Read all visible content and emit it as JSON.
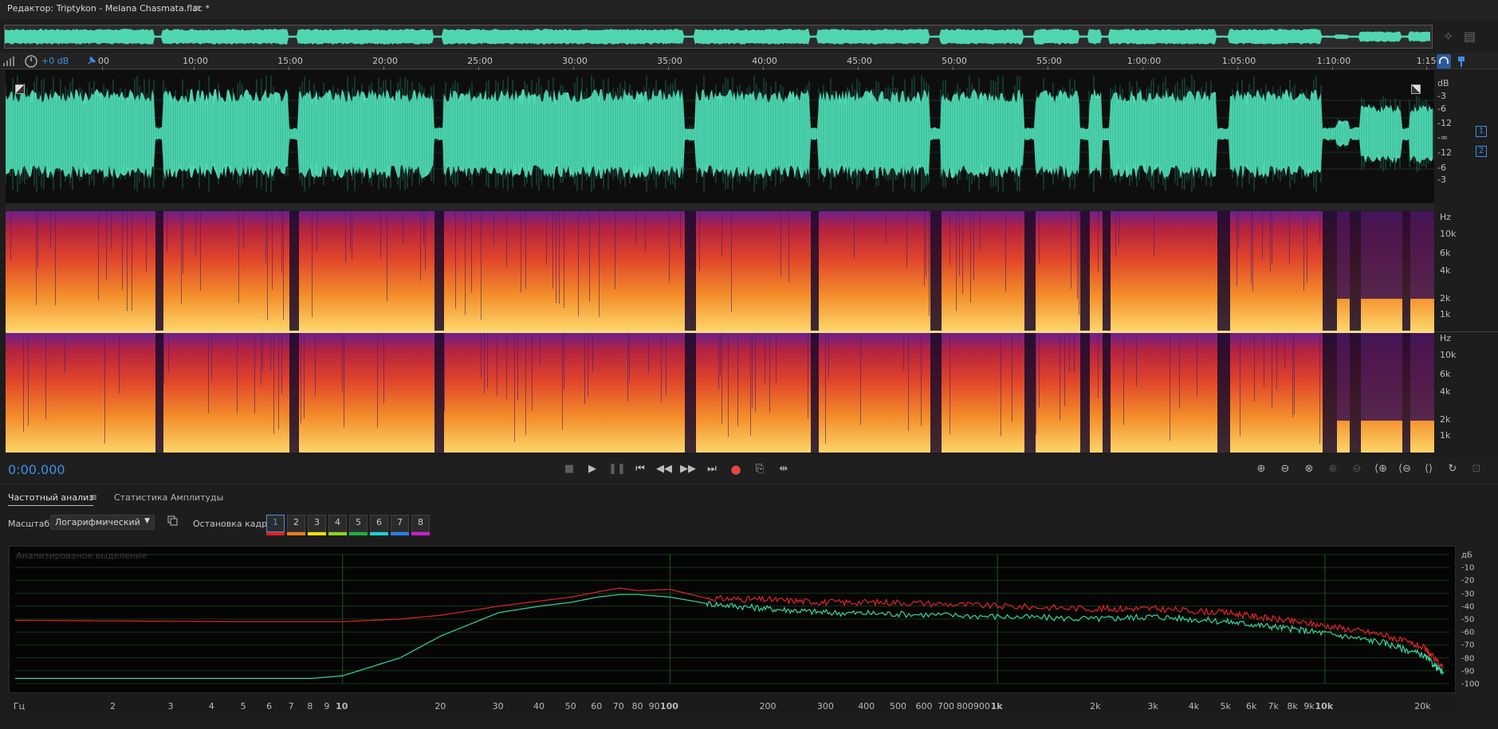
{
  "window": {
    "title": "Редактор: Triptykon - Melana Chasmata.flac *",
    "menu_icon": "hamburger-menu-icon"
  },
  "header": {
    "gain": "+0 dB"
  },
  "timeline": {
    "ticks": [
      "00",
      "10:00",
      "15:00",
      "20:00",
      "25:00",
      "30:00",
      "35:00",
      "40:00",
      "45:00",
      "50:00",
      "55:00",
      "1:00:00",
      "1:05:00",
      "1:10:00",
      "1:15:"
    ]
  },
  "waveform": {
    "db_labels": [
      "dB",
      "-3",
      "-6",
      "-12",
      "-∞",
      "-12",
      "-6",
      "-3"
    ],
    "channels": [
      "1",
      "2"
    ],
    "color": "#4fd6b0"
  },
  "spectrogram": {
    "labels": [
      "Hz",
      "10k",
      "6k",
      "4k",
      "2k",
      "1k"
    ]
  },
  "transport": {
    "time": "0:00.000",
    "buttons": [
      "stop-icon",
      "play-icon",
      "pause-icon",
      "skip-start-icon",
      "rewind-icon",
      "fast-forward-icon",
      "skip-end-icon",
      "record-icon",
      "loop-icon",
      "skip-selection-icon"
    ],
    "zoom_buttons": [
      "zoom-in-amplitude-icon",
      "zoom-out-amplitude-icon",
      "zoom-reset-icon",
      "zoom-in-time-icon",
      "zoom-out-time-icon",
      "zoom-selection-icon",
      "zoom-in-left-icon",
      "zoom-in-right-icon",
      "zoom-full-icon",
      "zoom-fit-icon",
      "zoom-extra-icon"
    ]
  },
  "panel": {
    "tab_active": "Частотный анализ",
    "tab_other": "Статистика Амплитуды",
    "scale_label": "Масштаб:",
    "scale_value": "Логарифмический",
    "freeze_label": "Остановка кадра:",
    "holds": [
      {
        "label": "1",
        "color": "#e02020"
      },
      {
        "label": "2",
        "color": "#f07d17"
      },
      {
        "label": "3",
        "color": "#f2e000"
      },
      {
        "label": "4",
        "color": "#8cd61a"
      },
      {
        "label": "5",
        "color": "#1ab43c"
      },
      {
        "label": "6",
        "color": "#14d6d6"
      },
      {
        "label": "7",
        "color": "#2a7df0"
      },
      {
        "label": "8",
        "color": "#d11ad1"
      }
    ]
  },
  "chart_data": {
    "type": "line",
    "note": "Анализированое выделение",
    "xscale": "log",
    "xlim": [
      1,
      24000
    ],
    "ylim": [
      -100,
      0
    ],
    "ylabel": "дБ",
    "x_ticks": [
      "Гц",
      "2",
      "3",
      "4",
      "5",
      "6",
      "7",
      "8",
      "9",
      "10",
      "20",
      "30",
      "40",
      "50",
      "60",
      "70",
      "80",
      "90",
      "100",
      "200",
      "300",
      "400",
      "500",
      "600",
      "700",
      "800",
      "900",
      "1k",
      "2k",
      "3k",
      "4k",
      "5k",
      "6k",
      "7k",
      "8k",
      "9k",
      "10k",
      "20k"
    ],
    "y_ticks": [
      "дБ",
      "-10",
      "-20",
      "-30",
      "-40",
      "-50",
      "-60",
      "-70",
      "-80",
      "-90",
      "-100"
    ],
    "series": [
      {
        "color": "#e02424",
        "points": [
          [
            1,
            -51
          ],
          [
            5,
            -52
          ],
          [
            10,
            -52
          ],
          [
            15,
            -50
          ],
          [
            20,
            -47
          ],
          [
            30,
            -40
          ],
          [
            40,
            -36
          ],
          [
            50,
            -33
          ],
          [
            60,
            -29
          ],
          [
            70,
            -26
          ],
          [
            80,
            -28
          ],
          [
            100,
            -27
          ],
          [
            130,
            -34
          ],
          [
            200,
            -35
          ],
          [
            300,
            -37
          ],
          [
            500,
            -37
          ],
          [
            1000,
            -40
          ],
          [
            2000,
            -42
          ],
          [
            3000,
            -42
          ],
          [
            5000,
            -45
          ],
          [
            7000,
            -50
          ],
          [
            10000,
            -55
          ],
          [
            15000,
            -62
          ],
          [
            20000,
            -72
          ],
          [
            23000,
            -88
          ]
        ]
      },
      {
        "color": "#36d6a0",
        "points": [
          [
            1,
            -96
          ],
          [
            5,
            -96
          ],
          [
            8,
            -96
          ],
          [
            10,
            -94
          ],
          [
            15,
            -80
          ],
          [
            20,
            -63
          ],
          [
            30,
            -45
          ],
          [
            40,
            -40
          ],
          [
            50,
            -37
          ],
          [
            60,
            -33
          ],
          [
            70,
            -31
          ],
          [
            80,
            -31
          ],
          [
            100,
            -33
          ],
          [
            130,
            -38
          ],
          [
            200,
            -42
          ],
          [
            300,
            -45
          ],
          [
            500,
            -46
          ],
          [
            1000,
            -48
          ],
          [
            2000,
            -50
          ],
          [
            3000,
            -48
          ],
          [
            5000,
            -52
          ],
          [
            7000,
            -56
          ],
          [
            10000,
            -61
          ],
          [
            15000,
            -68
          ],
          [
            20000,
            -78
          ],
          [
            23000,
            -92
          ]
        ]
      }
    ]
  }
}
